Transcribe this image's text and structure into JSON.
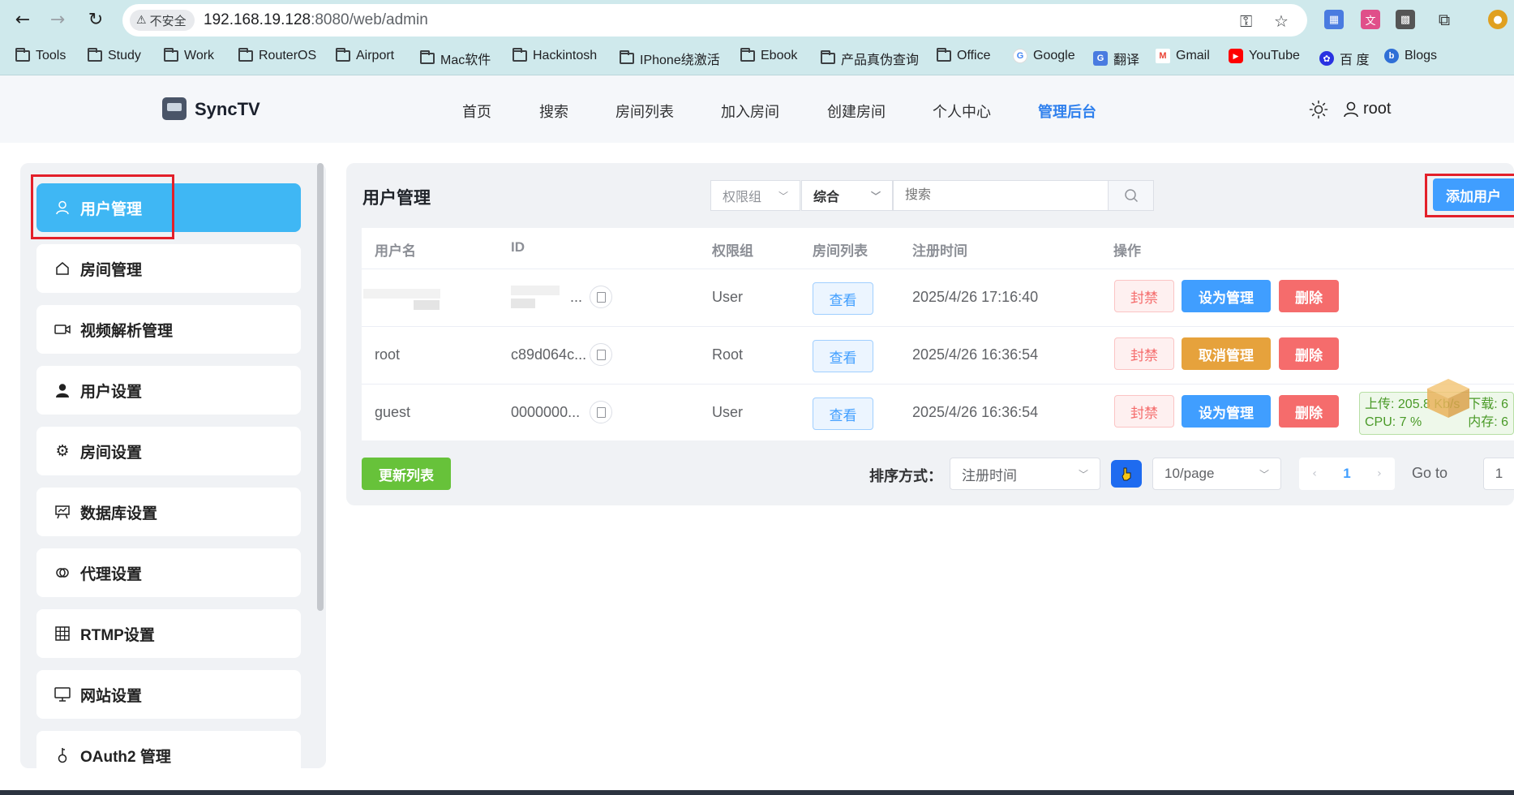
{
  "browser": {
    "security_label": "不安全",
    "url_host": "192.168.19.128",
    "url_rest": ":8080/web/admin",
    "bookmarks": [
      {
        "label": "Tools",
        "icon": "folder-icon"
      },
      {
        "label": "Study",
        "icon": "folder-icon"
      },
      {
        "label": "Work",
        "icon": "folder-icon"
      },
      {
        "label": "RouterOS",
        "icon": "folder-icon"
      },
      {
        "label": "Airport",
        "icon": "folder-icon"
      },
      {
        "label": "Mac软件",
        "icon": "folder-icon"
      },
      {
        "label": "Hackintosh",
        "icon": "folder-icon"
      },
      {
        "label": "IPhone绕激活",
        "icon": "folder-icon"
      },
      {
        "label": "Ebook",
        "icon": "folder-icon"
      },
      {
        "label": "产品真伪查询",
        "icon": "folder-icon"
      },
      {
        "label": "Office",
        "icon": "folder-icon"
      },
      {
        "label": "Google",
        "icon": "google-icon"
      },
      {
        "label": "翻译",
        "icon": "translate-icon"
      },
      {
        "label": "Gmail",
        "icon": "gmail-icon"
      },
      {
        "label": "YouTube",
        "icon": "youtube-icon"
      },
      {
        "label": "百 度",
        "icon": "baidu-icon"
      },
      {
        "label": "Blogs",
        "icon": "blogs-icon"
      }
    ]
  },
  "app": {
    "brand": "SyncTV",
    "nav": [
      "首页",
      "搜索",
      "房间列表",
      "加入房间",
      "创建房间",
      "个人中心",
      "管理后台"
    ],
    "active_nav": "管理后台",
    "username": "root"
  },
  "sidebar": {
    "items": [
      {
        "label": "用户管理",
        "icon": "user-outline-icon",
        "active": true
      },
      {
        "label": "房间管理",
        "icon": "home-icon"
      },
      {
        "label": "视频解析管理",
        "icon": "video-camera-icon"
      },
      {
        "label": "用户设置",
        "icon": "user-filled-icon"
      },
      {
        "label": "房间设置",
        "icon": "gear-icon"
      },
      {
        "label": "数据库设置",
        "icon": "presentation-icon"
      },
      {
        "label": "代理设置",
        "icon": "link-icon"
      },
      {
        "label": "RTMP设置",
        "icon": "grid-icon"
      },
      {
        "label": "网站设置",
        "icon": "monitor-icon"
      },
      {
        "label": "OAuth2 管理",
        "icon": "key-icon"
      }
    ]
  },
  "main": {
    "title": "用户管理",
    "filter_group_placeholder": "权限组",
    "filter_type": "综合",
    "search_placeholder": "搜索",
    "add_user_label": "添加用户",
    "columns": [
      "用户名",
      "ID",
      "权限组",
      "房间列表",
      "注册时间",
      "操作"
    ],
    "rows": [
      {
        "username": "",
        "id": "...",
        "group": "User",
        "rooms_label": "查看",
        "registered": "2025/4/26 17:16:40",
        "ban": "封禁",
        "admin_action": "设为管理",
        "admin_action_type": "set",
        "delete": "删除"
      },
      {
        "username": "root",
        "id": "c89d064c...",
        "group": "Root",
        "rooms_label": "查看",
        "registered": "2025/4/26 16:36:54",
        "ban": "封禁",
        "admin_action": "取消管理",
        "admin_action_type": "revoke",
        "delete": "删除"
      },
      {
        "username": "guest",
        "id": "0000000...",
        "group": "User",
        "rooms_label": "查看",
        "registered": "2025/4/26 16:36:54",
        "ban": "封禁",
        "admin_action": "设为管理",
        "admin_action_type": "set",
        "delete": "删除"
      }
    ],
    "refresh_label": "更新列表",
    "sort_label": "排序方式：",
    "sort_value": "注册时间",
    "page_size": "10/page",
    "current_page": "1",
    "goto_label": "Go to",
    "goto_value": "1"
  },
  "net_monitor": {
    "upload": "上传: 205.8 Kb/s",
    "download": "下载: 6",
    "cpu": "CPU: 7 %",
    "memory": "内存: 6"
  },
  "colors": {
    "primary": "#409eff",
    "sidebar_active": "#3fb7f4",
    "success": "#67c23a",
    "warning": "#e6a23c",
    "danger": "#f56c6c",
    "highlight_box": "#e3202a",
    "browser_chrome": "#cfe9ec"
  }
}
